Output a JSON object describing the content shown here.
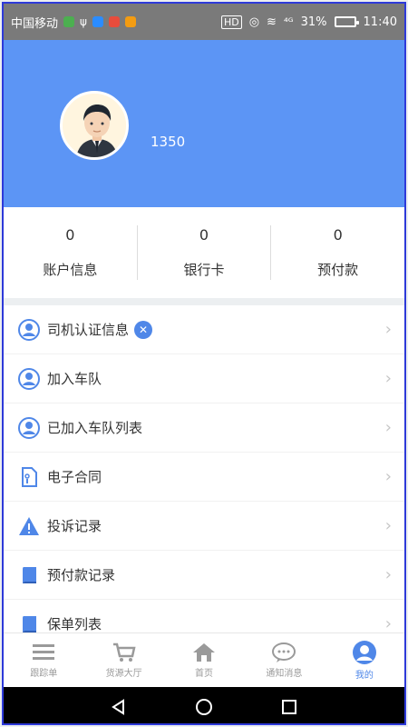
{
  "status_bar": {
    "carrier": "中国移动",
    "signal_text": "⁴ᴳ",
    "battery": "31%",
    "battery_fraction": 0.31,
    "time": "11:40"
  },
  "profile": {
    "phone": "1350"
  },
  "stats": [
    {
      "value": "0",
      "label": "账户信息"
    },
    {
      "value": "0",
      "label": "银行卡"
    },
    {
      "value": "0",
      "label": "预付款"
    }
  ],
  "menu": [
    {
      "label": "司机认证信息",
      "icon": "user-circle-icon"
    },
    {
      "label": "加入车队",
      "icon": "user-circle-icon"
    },
    {
      "label": "已加入车队列表",
      "icon": "user-circle-icon"
    },
    {
      "label": "电子合同",
      "icon": "document-icon"
    },
    {
      "label": "投诉记录",
      "icon": "warning-icon"
    },
    {
      "label": "预付款记录",
      "icon": "book-icon"
    },
    {
      "label": "保单列表",
      "icon": "book-icon"
    }
  ],
  "tabs": [
    {
      "label": "跟踪单",
      "icon": "list-icon"
    },
    {
      "label": "货源大厅",
      "icon": "cart-icon"
    },
    {
      "label": "首页",
      "icon": "home-icon"
    },
    {
      "label": "通知消息",
      "icon": "chat-icon"
    },
    {
      "label": "我的",
      "icon": "user-icon",
      "active": true
    }
  ],
  "colors": {
    "header": "#5c95f5",
    "accent": "#4f87e8",
    "frame": "#2e3ad9"
  }
}
